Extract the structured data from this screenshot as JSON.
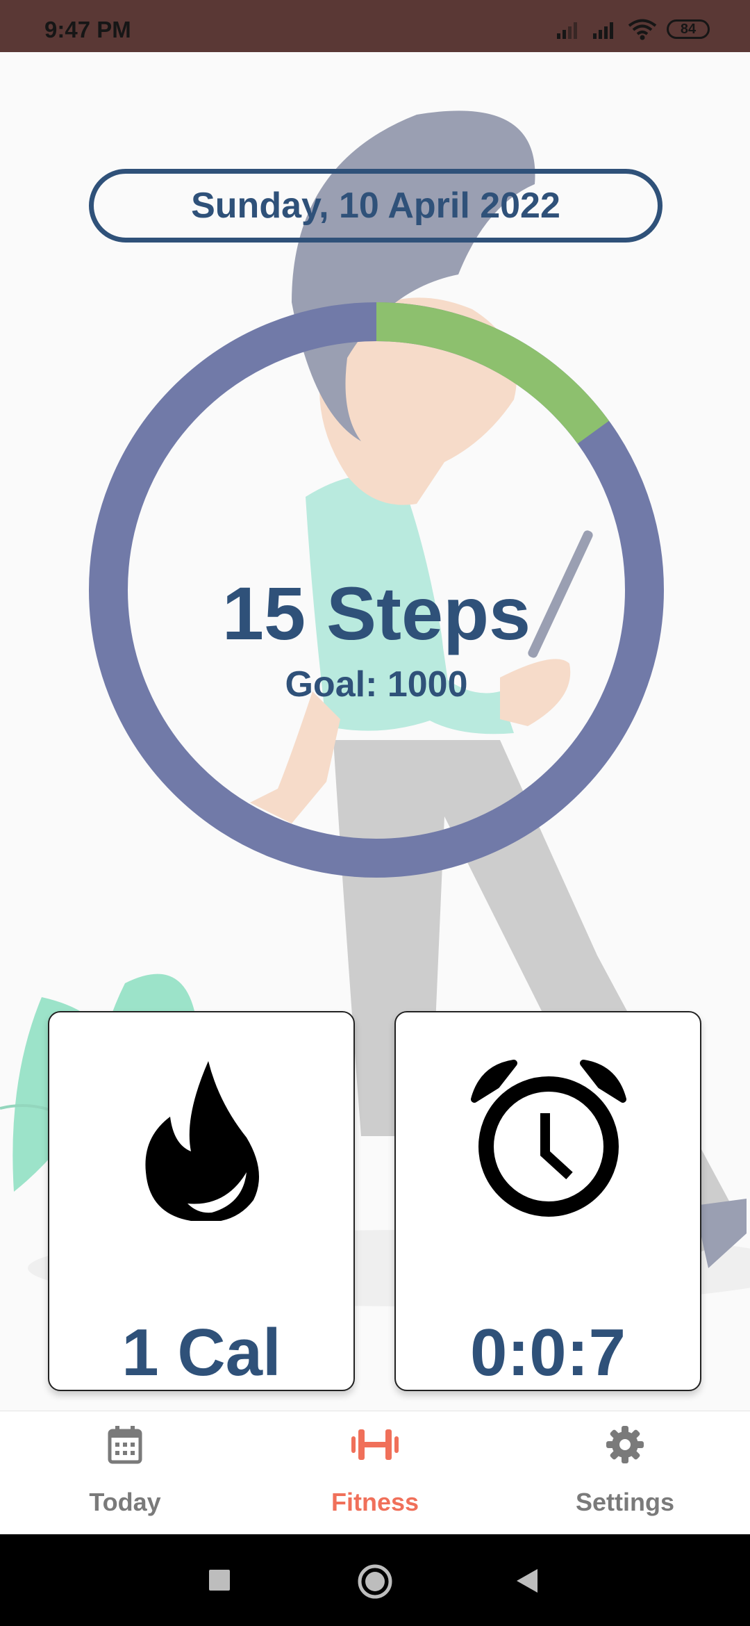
{
  "status_bar": {
    "time": "9:47 PM",
    "battery": "84"
  },
  "date": "Sunday, 10 April 2022",
  "progress": {
    "steps_label": "15 Steps",
    "goal_label": "Goal: 1000",
    "fraction": 0.15,
    "colors": {
      "track": "#717aa8",
      "fill": "#8dc06e"
    }
  },
  "cards": {
    "calories": {
      "icon": "flame-icon",
      "value": "1 Cal"
    },
    "duration": {
      "icon": "alarm-clock-icon",
      "value": "0:0:7"
    }
  },
  "bottom_nav": {
    "items": [
      {
        "label": "Today",
        "icon": "calendar-icon"
      },
      {
        "label": "Fitness",
        "icon": "dumbbell-icon",
        "active": true
      },
      {
        "label": "Settings",
        "icon": "gear-icon"
      }
    ],
    "active_color": "#f0705a"
  },
  "system_nav": [
    "recents-button",
    "home-button",
    "back-button"
  ]
}
